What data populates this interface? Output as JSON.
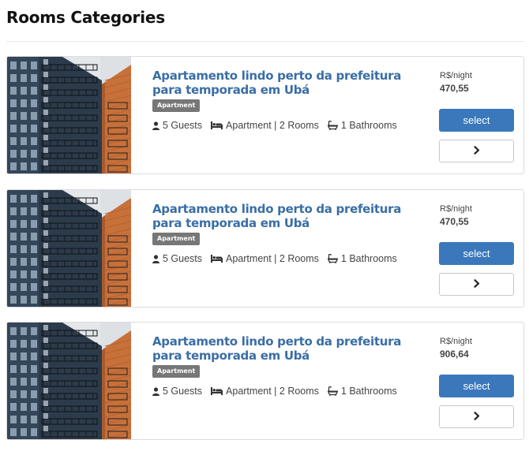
{
  "page": {
    "title": "Rooms Categories"
  },
  "rooms": [
    {
      "name": "Apartamento lindo perto da prefeitura para temporada em Ubá",
      "badge": "Apartment",
      "guests": "5 Guests",
      "room_type": "Apartment | 2 Rooms",
      "bathrooms": "1 Bathrooms",
      "price_unit": "R$/night",
      "price": "470,55",
      "select_label": "select",
      "details_icon": "chevron-right-icon"
    },
    {
      "name": "Apartamento lindo perto da prefeitura para temporada em Ubá",
      "badge": "Apartment",
      "guests": "5 Guests",
      "room_type": "Apartment | 2 Rooms",
      "bathrooms": "1 Bathrooms",
      "price_unit": "R$/night",
      "price": "470,55",
      "select_label": "select",
      "details_icon": "chevron-right-icon"
    },
    {
      "name": "Apartamento lindo perto da prefeitura para temporada em Ubá",
      "badge": "Apartment",
      "guests": "5 Guests",
      "room_type": "Apartment | 2 Rooms",
      "bathrooms": "1 Bathrooms",
      "price_unit": "R$/night",
      "price": "906,64",
      "select_label": "select",
      "details_icon": "chevron-right-icon"
    }
  ],
  "icons": {
    "guests": "user-icon",
    "room_type": "bed-icon",
    "bathrooms": "bathtub-icon"
  },
  "colors": {
    "title_link": "#3a6ea5",
    "select_button": "#3a78bb",
    "badge": "#777777"
  }
}
